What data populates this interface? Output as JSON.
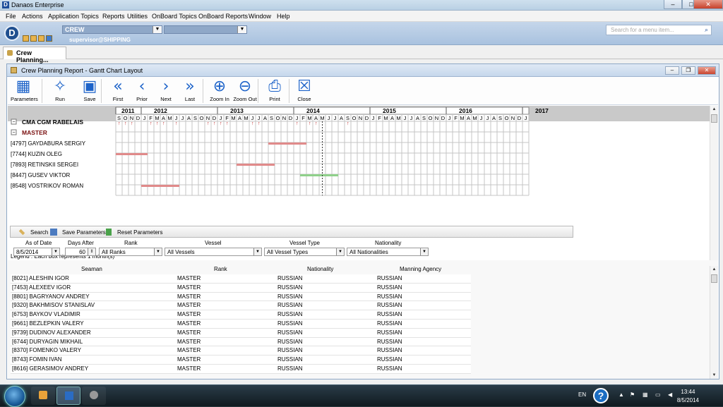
{
  "app": {
    "title": "Danaos Enterprise",
    "min": "–",
    "max": "□",
    "close": "✕"
  },
  "menu": [
    "File",
    "Actions",
    "Application Topics",
    "Reports",
    "Utilities",
    "OnBoard Topics",
    "OnBoard Reports",
    "Window",
    "Help"
  ],
  "header": {
    "module": "CREW",
    "user": "supervisor@SHIPPING",
    "search_placeholder": "Search for a menu item..."
  },
  "tab": {
    "label": "Crew Planning..."
  },
  "window": {
    "title": "Crew Planning Report - Gantt Chart Layout"
  },
  "toolbar": [
    {
      "label": "Parameters",
      "icon": "parameters-icon",
      "glyph": "▦"
    },
    {
      "label": "Run",
      "icon": "run-icon",
      "glyph": "✧"
    },
    {
      "label": "Save",
      "icon": "save-icon",
      "glyph": "▣"
    },
    {
      "label": "First",
      "icon": "first-icon",
      "glyph": "«"
    },
    {
      "label": "Prior",
      "icon": "prior-icon",
      "glyph": "‹"
    },
    {
      "label": "Next",
      "icon": "next-icon",
      "glyph": "›"
    },
    {
      "label": "Last",
      "icon": "last-icon",
      "glyph": "»"
    },
    {
      "label": "Zoom In",
      "icon": "zoom-in-icon",
      "glyph": "⊕"
    },
    {
      "label": "Zoom Out",
      "icon": "zoom-out-icon",
      "glyph": "⊖"
    },
    {
      "label": "Print",
      "icon": "print-icon",
      "glyph": "⎙"
    },
    {
      "label": "Close",
      "icon": "close-icon",
      "glyph": "☒"
    }
  ],
  "gantt": {
    "years": [
      {
        "label": "2011",
        "start": 0
      },
      {
        "label": "2012",
        "start": 4
      },
      {
        "label": "2013",
        "start": 16
      },
      {
        "label": "2014",
        "start": 28
      },
      {
        "label": "2015",
        "start": 40
      },
      {
        "label": "2016",
        "start": 52
      },
      {
        "label": "2017",
        "start": 64
      }
    ],
    "months": [
      "S",
      "O",
      "N",
      "D",
      "J",
      "F",
      "M",
      "A",
      "M",
      "J",
      "J",
      "A",
      "S",
      "O",
      "N",
      "D",
      "J",
      "F",
      "M",
      "A",
      "M",
      "J",
      "J",
      "A",
      "S",
      "O",
      "N",
      "D",
      "J",
      "F",
      "M",
      "A",
      "M",
      "J",
      "J",
      "A",
      "S",
      "O",
      "N",
      "D",
      "J",
      "F",
      "M",
      "A",
      "M",
      "J",
      "J",
      "A",
      "S",
      "O",
      "N",
      "D",
      "J",
      "F",
      "M",
      "A",
      "M",
      "J",
      "J",
      "A",
      "S",
      "O",
      "N",
      "D",
      "J"
    ],
    "vessel": "CMA CGM RABELAIS",
    "rank": "MASTER",
    "crew": [
      {
        "name": "[4797] GAYDABURA SERGIY",
        "start": 24,
        "end": 30,
        "color": "#e08a8a"
      },
      {
        "name": "[7744] KUZIN OLEG",
        "start": 0,
        "end": 5,
        "color": "#e08a8a"
      },
      {
        "name": "[7893] RETINSKII SERGEI",
        "start": 19,
        "end": 25,
        "color": "#e08a8a"
      },
      {
        "name": "[8447] GUSEV VIKTOR",
        "start": 29,
        "end": 35,
        "color": "#8fd08a"
      },
      {
        "name": "[8548] VOSTRIKOV ROMAN",
        "start": 4,
        "end": 10,
        "color": "#e08a8a"
      }
    ],
    "markers": [
      0,
      1,
      2,
      5,
      6,
      7,
      9,
      14,
      15,
      16,
      17,
      21,
      22,
      28,
      30,
      31,
      36
    ],
    "today": 32.5,
    "legend": "Legend : Each box represents 1 month(s)"
  },
  "search_bar": {
    "search": "Search",
    "save": "Save Parameters",
    "reset": "Reset Parameters"
  },
  "filters": {
    "as_of_label": "As of Date",
    "as_of": "8/5/2014",
    "days_label": "Days After",
    "days": "60",
    "rank_label": "Rank",
    "rank": "All Ranks",
    "vessel_label": "Vessel",
    "vessel": "All Vessels",
    "vtype_label": "Vessel Type",
    "vtype": "All Vessel Types",
    "nat_label": "Nationality",
    "nat": "All Nationalities"
  },
  "table": {
    "headers": [
      "Seaman",
      "Rank",
      "Nationality",
      "Manning Agency"
    ],
    "rows": [
      [
        "[8021] ALESHIN IGOR",
        "MASTER",
        "RUSSIAN",
        "RUSSIAN"
      ],
      [
        "[7453] ALEXEEV IGOR",
        "MASTER",
        "RUSSIAN",
        "RUSSIAN"
      ],
      [
        "[8801] BAGRYANOV ANDREY",
        "MASTER",
        "RUSSIAN",
        "RUSSIAN"
      ],
      [
        "[9320] BAKHMISOV STANISLAV",
        "MASTER",
        "RUSSIAN",
        "RUSSIAN"
      ],
      [
        "[6753] BAYKOV VLADIMIR",
        "MASTER",
        "RUSSIAN",
        "RUSSIAN"
      ],
      [
        "[9661] BEZLEPKIN VALERY",
        "MASTER",
        "RUSSIAN",
        "RUSSIAN"
      ],
      [
        "[9739] DUDINOV ALEXANDER",
        "MASTER",
        "RUSSIAN",
        "RUSSIAN"
      ],
      [
        "[6744] DURYAGIN MIKHAIL",
        "MASTER",
        "RUSSIAN",
        "RUSSIAN"
      ],
      [
        "[8370] FOMENKO VALERY",
        "MASTER",
        "RUSSIAN",
        "RUSSIAN"
      ],
      [
        "[8743] FOMIN IVAN",
        "MASTER",
        "RUSSIAN",
        "RUSSIAN"
      ],
      [
        "[8616] GERASIMOV ANDREY",
        "MASTER",
        "RUSSIAN",
        "RUSSIAN"
      ]
    ]
  },
  "taskbar": {
    "lang": "EN",
    "time": "13:44",
    "date": "8/5/2014"
  }
}
